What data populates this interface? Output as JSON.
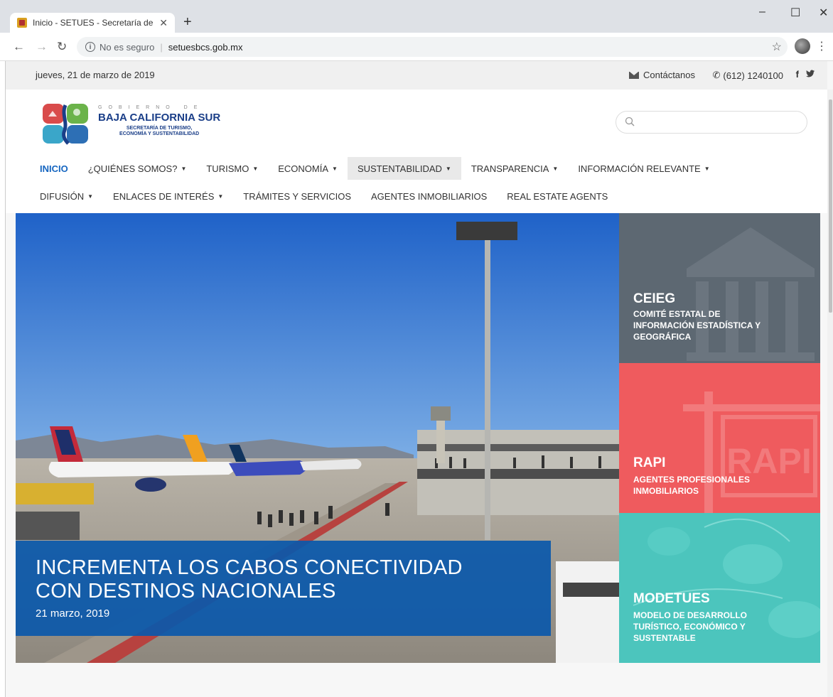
{
  "browser": {
    "tab_title": "Inicio - SETUES - Secretaría de Tu",
    "tab_close": "✕",
    "new_tab": "+",
    "security_label": "No es seguro",
    "url": "setuesbcs.gob.mx",
    "win_min": "–",
    "win_max": "☐",
    "win_close": "✕"
  },
  "topbar": {
    "date": "jueves, 21 de marzo de 2019",
    "contact": "Contáctanos",
    "phone": "(612) 1240100",
    "facebook": "f",
    "twitter": "🐦"
  },
  "logo": {
    "gobierno": "GOBIERNO DE",
    "state": "BAJA CALIFORNIA SUR",
    "secretaria_1": "SECRETARÍA DE TURISMO,",
    "secretaria_2": "ECONOMÍA Y SUSTENTABILIDAD"
  },
  "nav": {
    "row1": [
      {
        "label": "INICIO"
      },
      {
        "label": "¿QUIÉNES SOMOS?"
      },
      {
        "label": "TURISMO"
      },
      {
        "label": "ECONOMÍA"
      },
      {
        "label": "SUSTENTABILIDAD"
      },
      {
        "label": "TRANSPARENCIA"
      },
      {
        "label": "INFORMACIÓN RELEVANTE"
      }
    ],
    "row2": [
      {
        "label": "DIFUSIÓN"
      },
      {
        "label": "ENLACES DE INTERÉS"
      },
      {
        "label": "TRÁMITES Y SERVICIOS"
      },
      {
        "label": "AGENTES INMOBILIARIOS"
      },
      {
        "label": "REAL ESTATE AGENTS"
      }
    ],
    "caret": "▼"
  },
  "hero": {
    "headline_1": "INCREMENTA LOS CABOS CONECTIVIDAD",
    "headline_2": "CON DESTINOS NACIONALES",
    "date": "21 marzo, 2019"
  },
  "panels": [
    {
      "title": "CEIEG",
      "desc_1": "COMITÉ ESTATAL DE",
      "desc_2": "INFORMACIÓN ESTADÍSTICA Y",
      "desc_3": "GEOGRÁFICA",
      "color": "#5d6872"
    },
    {
      "title": "RAPI",
      "desc_1": "AGENTES PROFESIONALES",
      "desc_2": "INMOBILIARIOS",
      "desc_3": "",
      "color": "#ef5b5e",
      "sign": "RAPI"
    },
    {
      "title": "MODETUES",
      "desc_1": "MODELO DE DESARROLLO",
      "desc_2": "TURÍSTICO, ECONÓMICO Y",
      "desc_3": "SUSTENTABLE",
      "color": "#4cc5bd"
    }
  ]
}
